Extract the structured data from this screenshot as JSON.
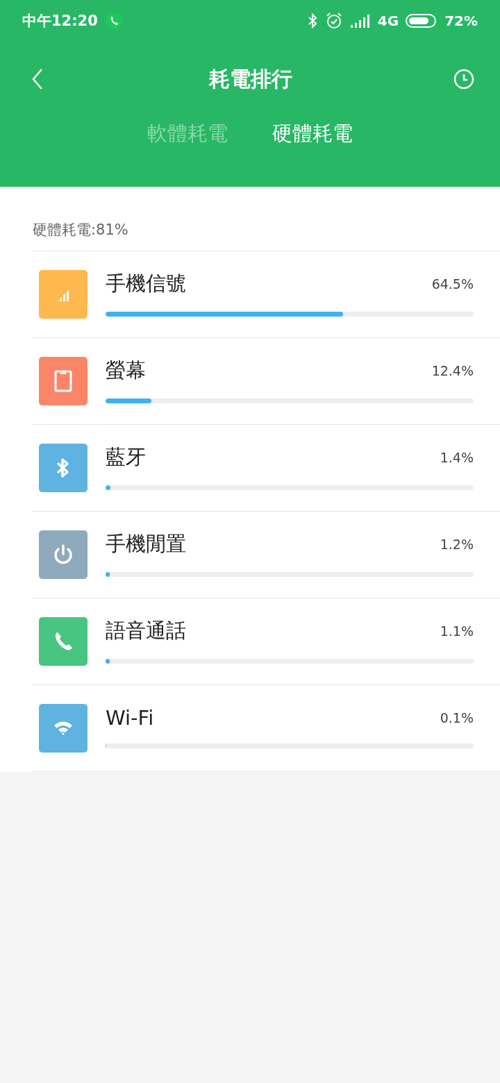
{
  "status_bar": {
    "time": "中午12:20",
    "network": "4G",
    "battery": "72%"
  },
  "header": {
    "title": "耗電排行"
  },
  "tabs": [
    {
      "label": "軟體耗電",
      "selected": false
    },
    {
      "label": "硬體耗電",
      "selected": true
    }
  ],
  "summary": "硬體耗電:81%",
  "items": [
    {
      "name": "手機信號",
      "percent": "64.5%",
      "level": 0.645,
      "kind": "signal",
      "color": "#ffb84d"
    },
    {
      "name": "螢幕",
      "percent": "12.4%",
      "level": 0.124,
      "kind": "screen",
      "color": "#fa866a"
    },
    {
      "name": "藍牙",
      "percent": "1.4%",
      "level": 0.014,
      "kind": "bluetooth",
      "color": "#5fb3e0"
    },
    {
      "name": "手機閒置",
      "percent": "1.2%",
      "level": 0.012,
      "kind": "power",
      "color": "#8fa9bd"
    },
    {
      "name": "語音通話",
      "percent": "1.1%",
      "level": 0.011,
      "kind": "phone",
      "color": "#48c580"
    },
    {
      "name": "Wi-Fi",
      "percent": "0.1%",
      "level": 0.001,
      "kind": "wifi",
      "color": "#5fb3e0"
    }
  ]
}
